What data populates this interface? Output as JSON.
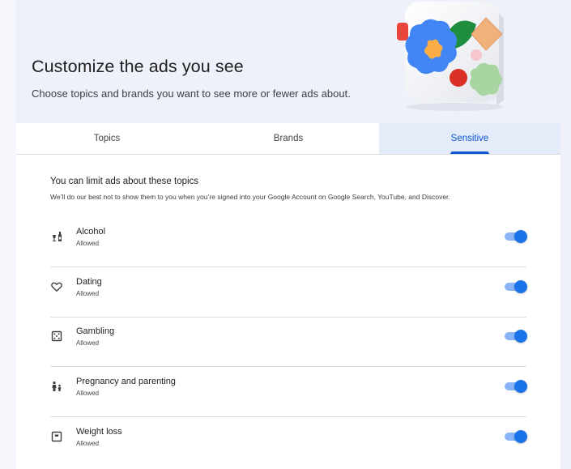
{
  "header": {
    "title": "Customize the ads you see",
    "subtitle": "Choose topics and brands you want to see more or fewer ads about."
  },
  "tabs": [
    {
      "label": "Topics",
      "active": false
    },
    {
      "label": "Brands",
      "active": false
    },
    {
      "label": "Sensitive",
      "active": true
    }
  ],
  "section": {
    "title": "You can limit ads about these topics",
    "description": "We’ll do our best not to show them to you when you’re signed into your Google Account on Google Search, YouTube, and Discover."
  },
  "topics": [
    {
      "name": "Alcohol",
      "status": "Allowed",
      "icon": "alcohol-icon",
      "enabled": true
    },
    {
      "name": "Dating",
      "status": "Allowed",
      "icon": "heart-icon",
      "enabled": true
    },
    {
      "name": "Gambling",
      "status": "Allowed",
      "icon": "dice-icon",
      "enabled": true
    },
    {
      "name": "Pregnancy and parenting",
      "status": "Allowed",
      "icon": "parent-child-icon",
      "enabled": true
    },
    {
      "name": "Weight loss",
      "status": "Allowed",
      "icon": "scale-icon",
      "enabled": true
    }
  ],
  "colors": {
    "accent": "#0b57d0",
    "toggle_thumb": "#1a73e8",
    "toggle_track": "#8ab4f8",
    "active_tab_bg": "#e4ebf9",
    "hero_bg": "#eef1fa"
  }
}
